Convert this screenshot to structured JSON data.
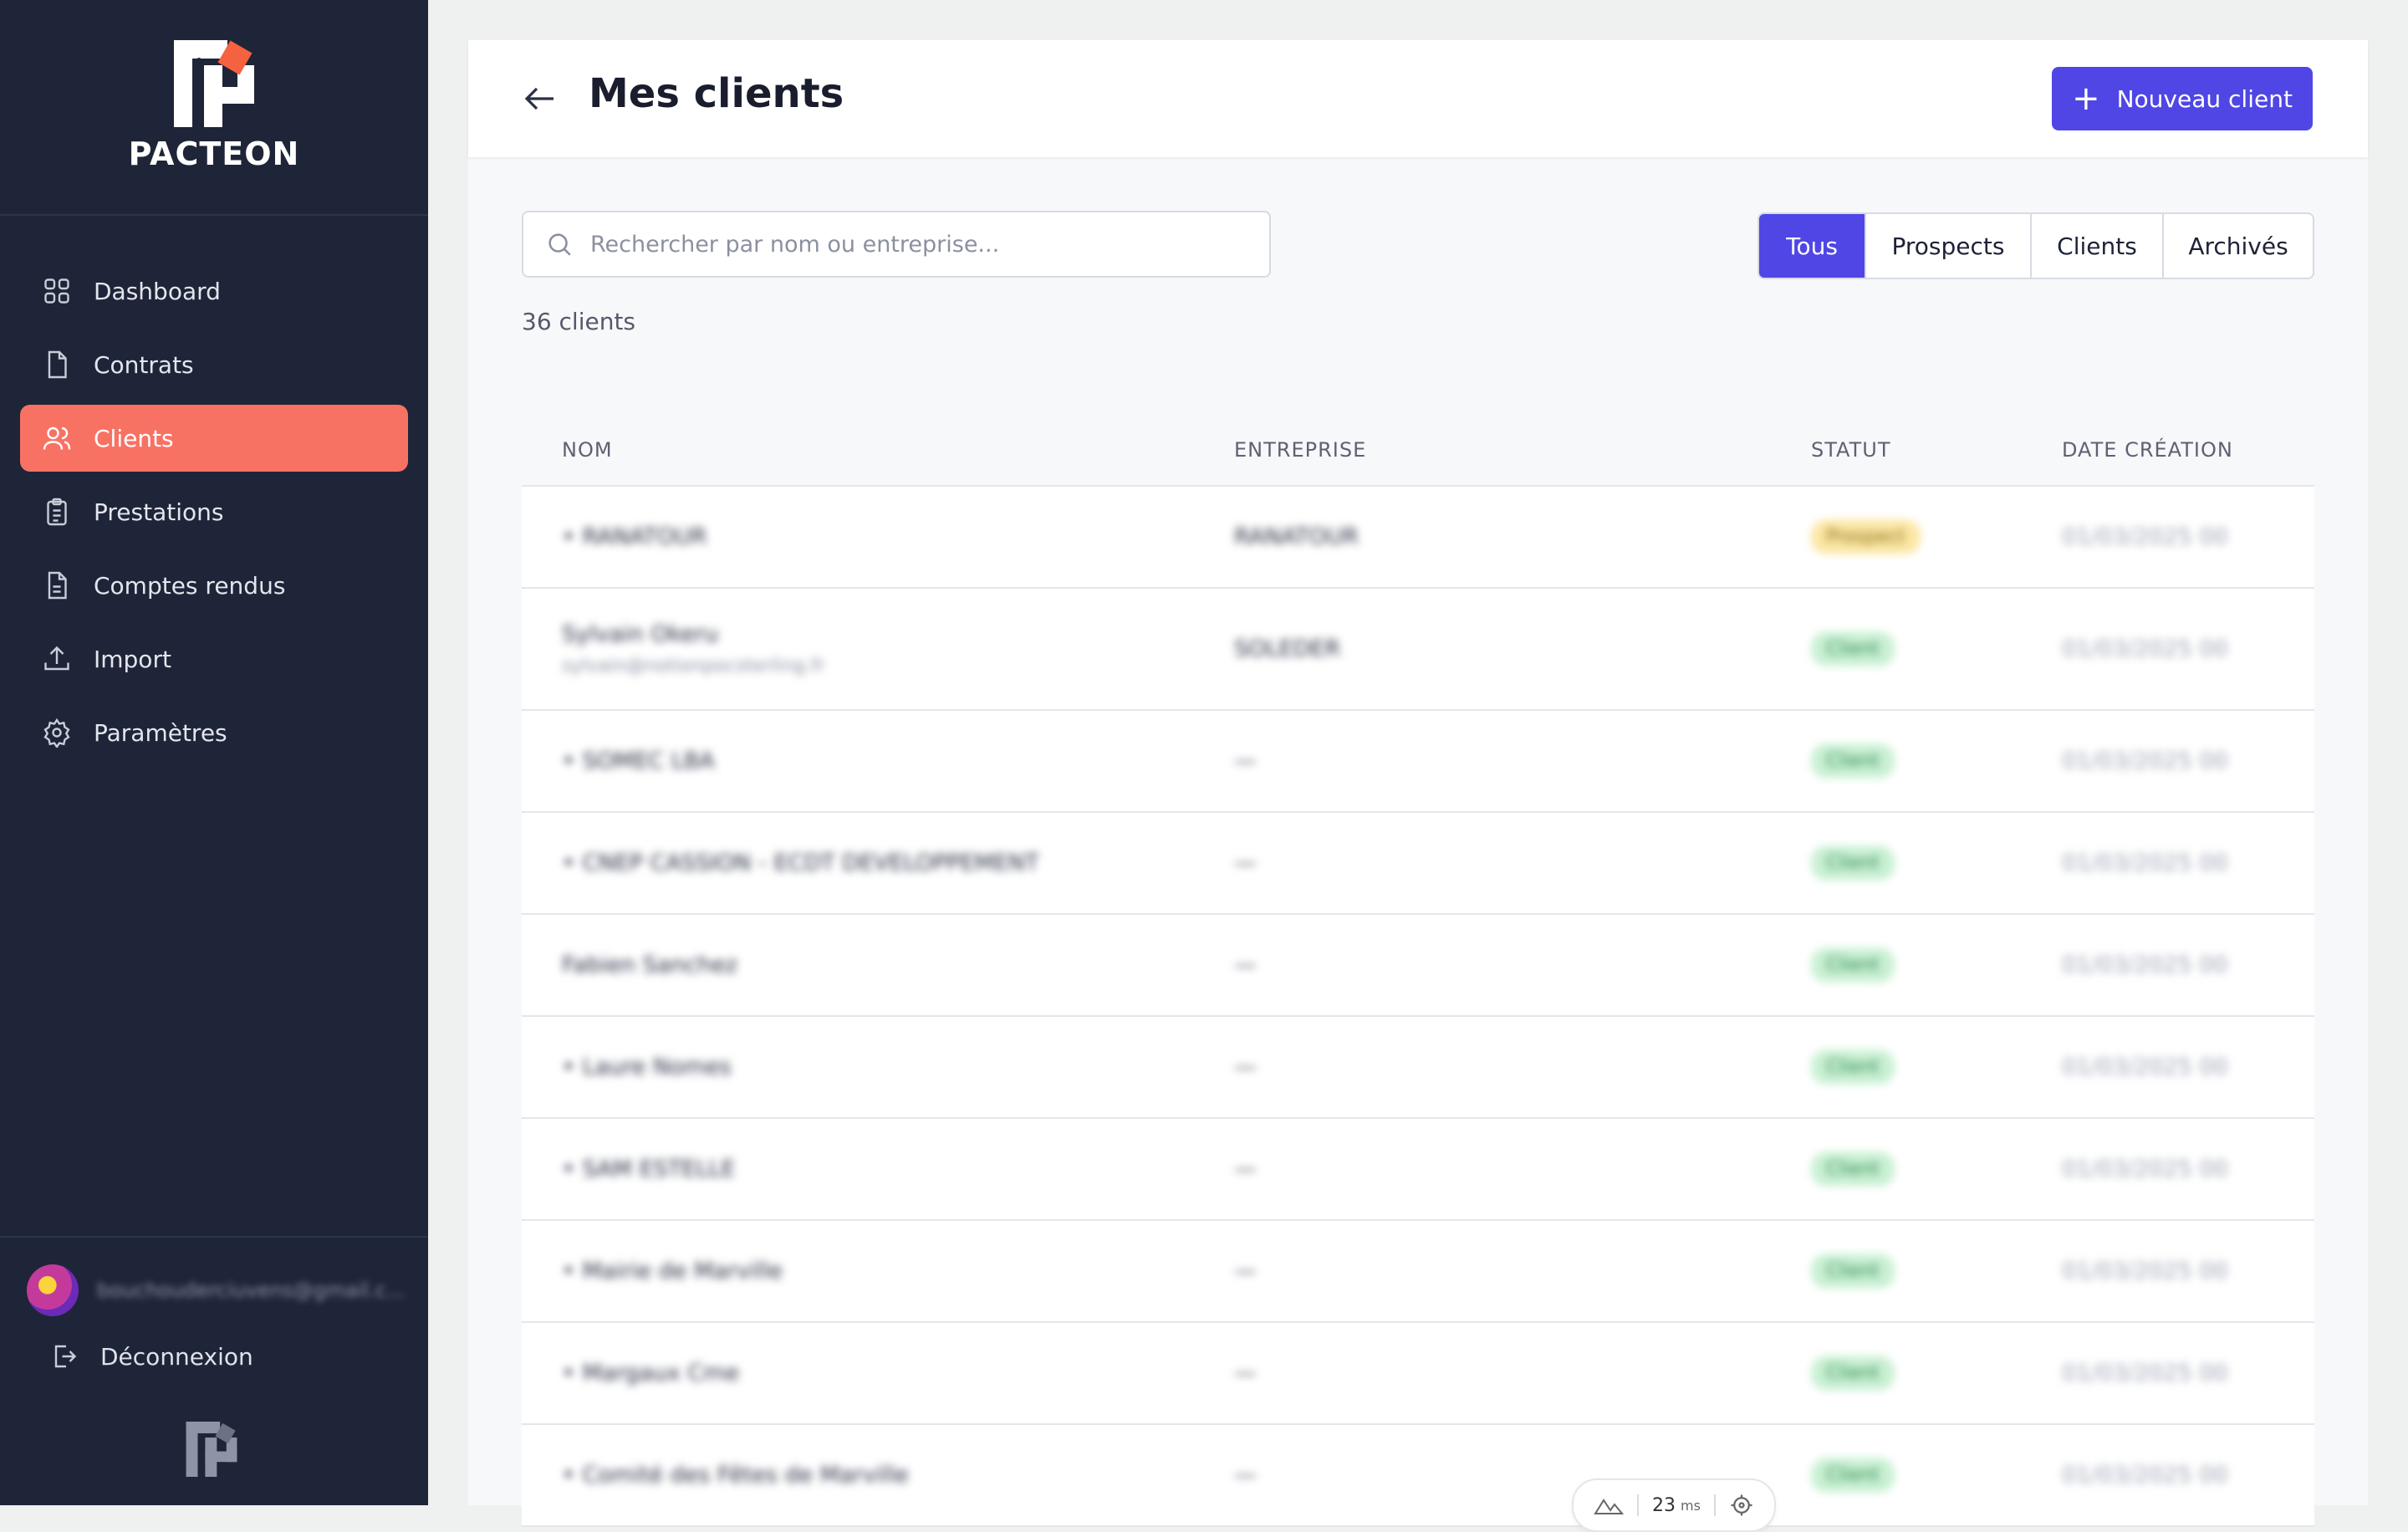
{
  "brand": {
    "name": "PACTEON",
    "accent": "#f87264",
    "primary": "#4f46e5"
  },
  "sidebar": {
    "items": [
      {
        "label": "Dashboard",
        "icon": "grid-icon",
        "active": false
      },
      {
        "label": "Contrats",
        "icon": "file-icon",
        "active": false
      },
      {
        "label": "Clients",
        "icon": "users-icon",
        "active": true
      },
      {
        "label": "Prestations",
        "icon": "clipboard-icon",
        "active": false
      },
      {
        "label": "Comptes rendus",
        "icon": "document-icon",
        "active": false
      },
      {
        "label": "Import",
        "icon": "upload-icon",
        "active": false
      },
      {
        "label": "Paramètres",
        "icon": "settings-icon",
        "active": false
      }
    ],
    "user_email": "bouchouderciuvens@gmail.c...",
    "logout_label": "Déconnexion"
  },
  "header": {
    "title": "Mes clients",
    "new_button_label": "Nouveau client"
  },
  "search": {
    "placeholder": "Rechercher par nom ou entreprise..."
  },
  "filters": [
    "Tous",
    "Prospects",
    "Clients",
    "Archivés"
  ],
  "count_label": "36 clients",
  "table": {
    "columns": [
      "NOM",
      "ENTREPRISE",
      "STATUT",
      "DATE CRÉATION"
    ],
    "rows": [
      {
        "name": "• RANATOUR",
        "sub": "",
        "company": "RANATOUR",
        "status": "Prospect",
        "status_type": "prospect",
        "date": "01/03/2025 00"
      },
      {
        "name": "Sylvain Okeru",
        "sub": "sylvain@notionpocsterling.fr",
        "company": "SOLEDER",
        "status": "Client",
        "status_type": "client",
        "date": "01/03/2025 00"
      },
      {
        "name": "• SOMEC LBA",
        "sub": "",
        "company": "—",
        "status": "Client",
        "status_type": "client",
        "date": "01/03/2025 00"
      },
      {
        "name": "• CNEP CASSION - ECDT DEVELOPPEMENT",
        "sub": "",
        "company": "—",
        "status": "Client",
        "status_type": "client",
        "date": "01/03/2025 00"
      },
      {
        "name": "Fabien Sanchez",
        "sub": "",
        "company": "—",
        "status": "Client",
        "status_type": "client",
        "date": "01/03/2025 00"
      },
      {
        "name": "• Laure Nomes",
        "sub": "",
        "company": "—",
        "status": "Client",
        "status_type": "client",
        "date": "01/03/2025 00"
      },
      {
        "name": "• SAM ESTELLE",
        "sub": "",
        "company": "—",
        "status": "Client",
        "status_type": "client",
        "date": "01/03/2025 00"
      },
      {
        "name": "• Mairie de Marville",
        "sub": "",
        "company": "—",
        "status": "Client",
        "status_type": "client",
        "date": "01/03/2025 00"
      },
      {
        "name": "• Margaux Cme",
        "sub": "",
        "company": "—",
        "status": "Client",
        "status_type": "client",
        "date": "01/03/2025 00"
      },
      {
        "name": "• Comité des Fêtes de Marville",
        "sub": "",
        "company": "—",
        "status": "Client",
        "status_type": "client",
        "date": "01/03/2025 00"
      }
    ]
  },
  "perf": {
    "value": "23",
    "unit": "ms"
  }
}
